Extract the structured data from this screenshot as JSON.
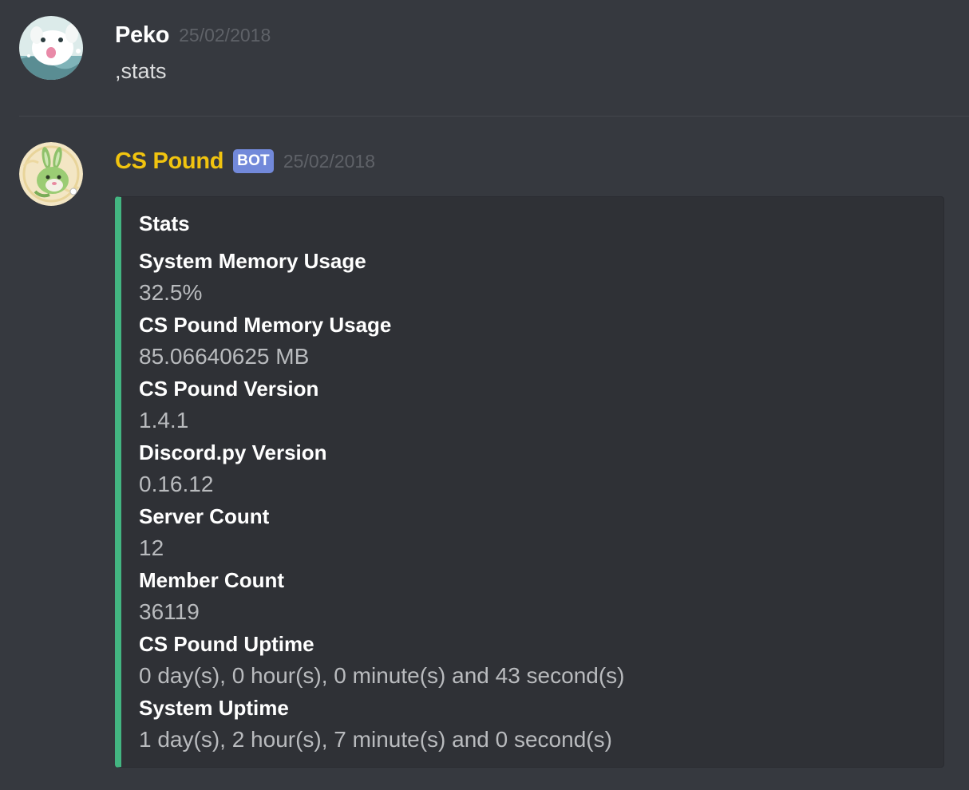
{
  "messages": [
    {
      "author": "Peko",
      "author_color": "#ffffff",
      "timestamp": "25/02/2018",
      "content": ",stats"
    },
    {
      "author": "CS Pound",
      "author_color": "#f1c40f",
      "bot_tag": "BOT",
      "timestamp": "25/02/2018",
      "embed": {
        "accent_color": "#43b581",
        "title": "Stats",
        "fields": [
          {
            "name": "System Memory Usage",
            "value": "32.5%"
          },
          {
            "name": "CS Pound Memory Usage",
            "value": "85.06640625 MB"
          },
          {
            "name": "CS Pound Version",
            "value": "1.4.1"
          },
          {
            "name": "Discord.py Version",
            "value": "0.16.12"
          },
          {
            "name": "Server Count",
            "value": "12"
          },
          {
            "name": "Member Count",
            "value": "36119"
          },
          {
            "name": "CS Pound Uptime",
            "value": "0 day(s), 0 hour(s), 0 minute(s) and 43 second(s)"
          },
          {
            "name": "System Uptime",
            "value": "1 day(s), 2 hour(s), 7 minute(s) and 0 second(s)"
          }
        ]
      }
    }
  ]
}
